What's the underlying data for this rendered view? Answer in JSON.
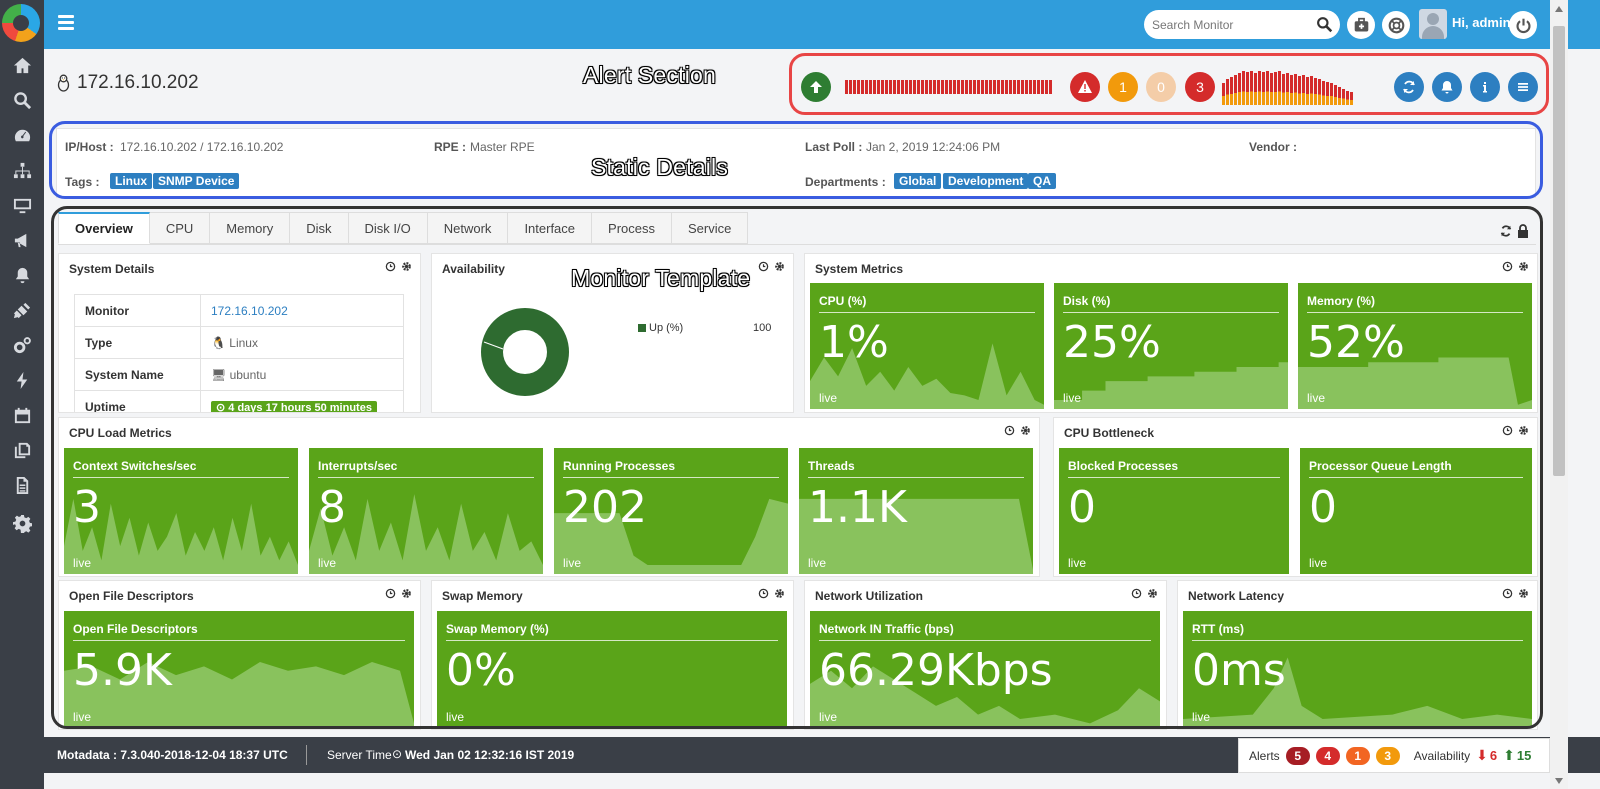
{
  "header": {
    "search_placeholder": "Search Monitor",
    "greeting": "Hi, admin"
  },
  "page": {
    "title": "172.16.10.202"
  },
  "annotations": {
    "alert_section": "Alert Section",
    "static_details": "Static Details",
    "monitor_template": "Monitor Template"
  },
  "alert_bar": {
    "counts": [
      "1",
      "0",
      "3"
    ]
  },
  "static_details": {
    "ip_label": "IP/Host :",
    "ip_value": "172.16.10.202 / 172.16.10.202",
    "rpe_label": "RPE :",
    "rpe_value": "Master RPE",
    "poll_label": "Last Poll :",
    "poll_value": "Jan 2, 2019 12:24:06 PM",
    "vendor_label": "Vendor :",
    "tags_label": "Tags :",
    "tags": [
      "Linux",
      "SNMP Device"
    ],
    "departments_label": "Departments :",
    "departments": [
      "Global",
      "Development",
      "QA"
    ]
  },
  "tabs": [
    "Overview",
    "CPU",
    "Memory",
    "Disk",
    "Disk I/O",
    "Network",
    "Interface",
    "Process",
    "Service"
  ],
  "system_details": {
    "title": "System Details",
    "rows": [
      {
        "key": "Monitor",
        "value": "172.16.10.202"
      },
      {
        "key": "Type",
        "value": "Linux"
      },
      {
        "key": "System Name",
        "value": "ubuntu"
      },
      {
        "key": "Uptime",
        "value": "4 days 17 hours 50 minutes"
      }
    ]
  },
  "availability": {
    "title": "Availability",
    "legend_label": "Up (%)",
    "legend_value": "100",
    "up_percent": 100
  },
  "panels": {
    "system_metrics": "System Metrics",
    "cpu_load": "CPU Load Metrics",
    "cpu_bottleneck": "CPU Bottleneck",
    "open_fd": "Open File Descriptors",
    "swap": "Swap Memory",
    "netutil": "Network Utilization",
    "netlat": "Network Latency"
  },
  "tiles": {
    "cpu": {
      "title": "CPU (%)",
      "value": "1%",
      "live": "live"
    },
    "disk": {
      "title": "Disk (%)",
      "value": "25%",
      "live": "live"
    },
    "memory": {
      "title": "Memory (%)",
      "value": "52%",
      "live": "live"
    },
    "ctx": {
      "title": "Context Switches/sec",
      "value": "3",
      "live": "live"
    },
    "intr": {
      "title": "Interrupts/sec",
      "value": "8",
      "live": "live"
    },
    "proc": {
      "title": "Running Processes",
      "value": "202",
      "live": "live"
    },
    "threads": {
      "title": "Threads",
      "value": "1.1K",
      "live": "live"
    },
    "blocked": {
      "title": "Blocked Processes",
      "value": "0",
      "live": "live"
    },
    "pql": {
      "title": "Processor Queue Length",
      "value": "0",
      "live": "live"
    },
    "ofd": {
      "title": "Open File Descriptors",
      "value": "5.9K",
      "live": "live"
    },
    "swap": {
      "title": "Swap Memory (%)",
      "value": "0%",
      "live": "live"
    },
    "netin": {
      "title": "Network IN Traffic (bps)",
      "value": "66.29Kbps",
      "live": "live"
    },
    "rtt": {
      "title": "RTT (ms)",
      "value": "0ms",
      "live": "live"
    }
  },
  "footer": {
    "version": "Motadata : 7.3.040-2018-12-04 18:37 UTC",
    "server_time_label": "Server Time",
    "server_time": "Wed Jan 02 12:32:16 IST 2019",
    "alerts_label": "Alerts",
    "alert_counts": [
      "5",
      "4",
      "1",
      "3"
    ],
    "availability_label": "Availability",
    "down": "6",
    "up": "15"
  },
  "colors": {
    "accent": "#309ddb",
    "tile_green": "#5aa419",
    "critical": "#d42b2b",
    "major": "#f29a0c",
    "minor": "#f4cda8",
    "up": "#2e7d32"
  }
}
